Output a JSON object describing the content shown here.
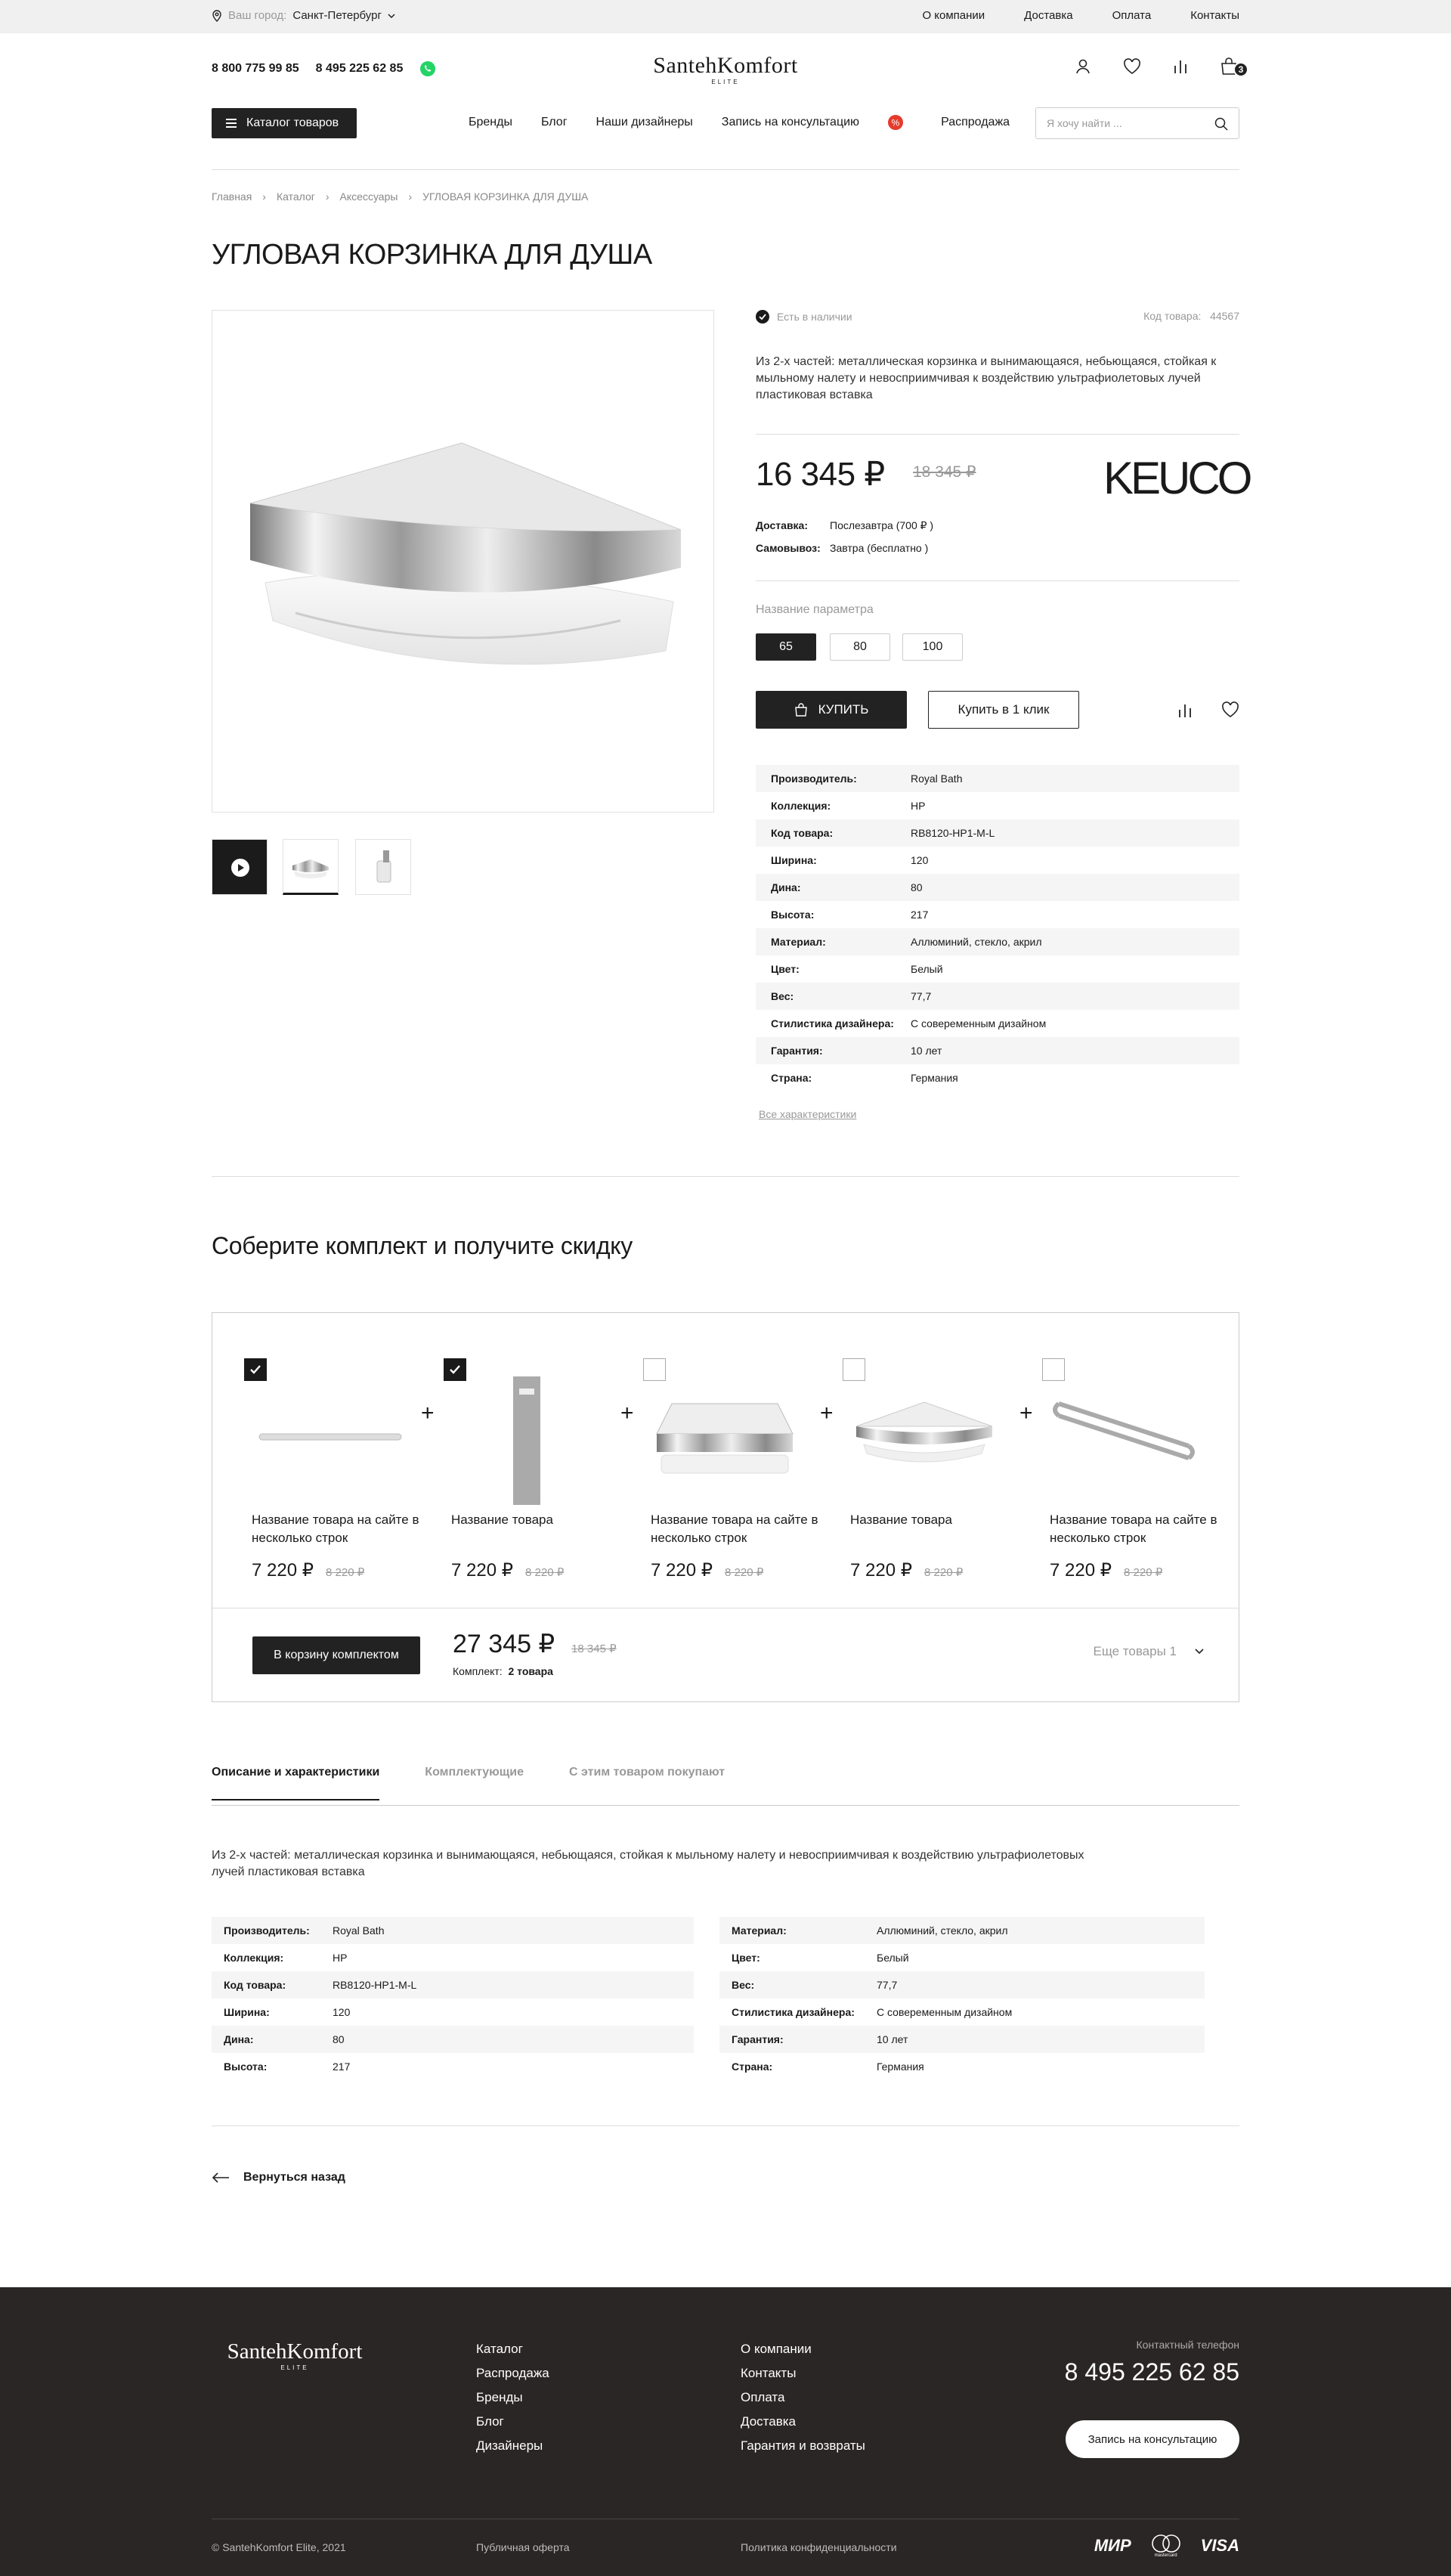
{
  "topbar": {
    "city_label": "Ваш город:",
    "city": "Санкт-Петербург",
    "links": [
      "О компании",
      "Доставка",
      "Оплата",
      "Контакты"
    ]
  },
  "header": {
    "phone1": "8 800 775 99 85",
    "phone2": "8 495 225 62 85",
    "logo_main": "SantehKomfort",
    "logo_sub": "ELITE",
    "cart_count": "3"
  },
  "nav": {
    "catalog_button": "Каталог товаров",
    "items": [
      "Бренды",
      "Блог",
      "Наши дизайнеры",
      "Запись на консультацию",
      "Распродажа"
    ],
    "search_placeholder": "Я хочу найти ..."
  },
  "breadcrumbs": [
    "Главная",
    "Каталог",
    "Аксессуары",
    "УГЛОВАЯ КОРЗИНКА ДЛЯ ДУША"
  ],
  "product": {
    "title": "УГЛОВАЯ КОРЗИНКА ДЛЯ ДУША",
    "stock": "Есть в наличии",
    "code_label": "Код товара:",
    "code": "44567",
    "description": "Из 2-х частей: металлическая корзинка и вынимающаяся, небьющаяся, стойкая к мыльному налету и невосприимчивая к воздействию ультрафиолетовых лучей пластиковая вставка",
    "price": "16 345 ₽",
    "old_price": "18 345 ₽",
    "brand": "KEUCO",
    "delivery_label": "Доставка:",
    "delivery": "Послезавтра (700 ₽ )",
    "pickup_label": "Самовывоз:",
    "pickup": "Завтра (бесплатно )",
    "param_label": "Название параметра",
    "options": [
      "65",
      "80",
      "100"
    ],
    "buy": "КУПИТЬ",
    "one_click": "Купить в 1 клик",
    "specs": [
      [
        "Производитель:",
        "Royal Bath"
      ],
      [
        "Коллекция:",
        "HP"
      ],
      [
        "Код товара:",
        "RB8120-HP1-M-L"
      ],
      [
        "Ширина:",
        "120"
      ],
      [
        "Дина:",
        "80"
      ],
      [
        "Высота:",
        "217"
      ],
      [
        "Материал:",
        "Аллюминий, стекло, акрил"
      ],
      [
        "Цвет:",
        "Белый"
      ],
      [
        "Вес:",
        "77,7"
      ],
      [
        "Стилистика дизайнера:",
        "С совеременным дизайном"
      ],
      [
        "Гарантия:",
        "10 лет"
      ],
      [
        "Страна:",
        "Германия"
      ]
    ],
    "all_specs": "Все характеристики"
  },
  "set": {
    "title": "Соберите комплект и получите скидку",
    "items": [
      {
        "name": "Название товара на сайте в несколько строк",
        "price": "7 220 ₽",
        "old": "8 220 ₽",
        "checked": true
      },
      {
        "name": "Название товара",
        "price": "7 220 ₽",
        "old": "8 220 ₽",
        "checked": true
      },
      {
        "name": "Название товара на сайте в несколько строк",
        "price": "7 220 ₽",
        "old": "8 220 ₽",
        "checked": false
      },
      {
        "name": "Название товара",
        "price": "7 220 ₽",
        "old": "8 220 ₽",
        "checked": false
      },
      {
        "name": "Название товара на сайте в несколько строк",
        "price": "7 220 ₽",
        "old": "8 220 ₽",
        "checked": false
      }
    ],
    "to_cart": "В корзину комплектом",
    "total": "27 345 ₽",
    "total_old": "18 345 ₽",
    "kit_label": "Комплект:",
    "kit_count": "2 товара",
    "more": "Еще товары 1"
  },
  "tabs": [
    "Описание и характеристики",
    "Комплектующие",
    "С этим товаром покупают"
  ],
  "tab_desc": "Из 2-х частей: металлическая корзинка и вынимающаяся, небьющаяся, стойкая к мыльному налету и невосприимчивая к воздействию ультрафиолетовых лучей пластиковая вставка",
  "specs_left": [
    [
      "Производитель:",
      "Royal Bath"
    ],
    [
      "Коллекция:",
      "HP"
    ],
    [
      "Код товара:",
      "RB8120-HP1-M-L"
    ],
    [
      "Ширина:",
      "120"
    ],
    [
      "Дина:",
      "80"
    ],
    [
      "Высота:",
      "217"
    ]
  ],
  "specs_right": [
    [
      "Материал:",
      "Аллюминий, стекло, акрил"
    ],
    [
      "Цвет:",
      "Белый"
    ],
    [
      "Вес:",
      "77,7"
    ],
    [
      "Стилистика дизайнера:",
      "С совеременным дизайном"
    ],
    [
      "Гарантия:",
      "10 лет"
    ],
    [
      "Страна:",
      "Германия"
    ]
  ],
  "back": "Вернуться назад",
  "footer": {
    "logo_main": "SantehKomfort",
    "logo_sub": "ELITE",
    "col1": [
      "Каталог",
      "Распродажа",
      "Бренды",
      "Блог",
      "Дизайнеры"
    ],
    "col2": [
      "О компании",
      "Контакты",
      "Оплата",
      "Доставка",
      "Гарантия и возвраты"
    ],
    "phone_label": "Контактный телефон",
    "phone": "8 495 225 62 85",
    "consult": "Запись на консультацию",
    "copyright": "© SantehKomfort Elite, 2021",
    "offer": "Публичная оферта",
    "privacy": "Политика конфиденциальности",
    "pay": [
      "МИР",
      "mastercard",
      "VISA"
    ]
  }
}
